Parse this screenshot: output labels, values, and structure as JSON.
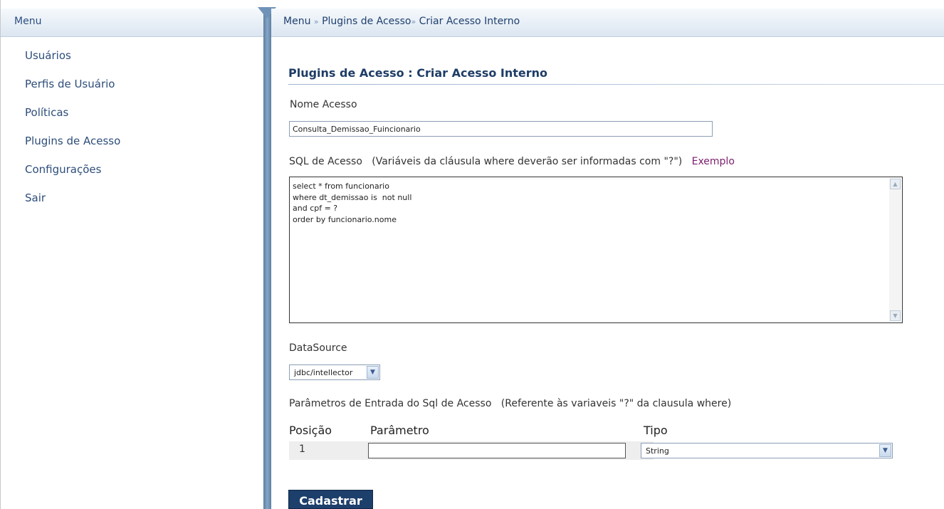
{
  "sidebar": {
    "title": "Menu",
    "items": [
      {
        "label": "Usuários"
      },
      {
        "label": "Perfis de Usuário"
      },
      {
        "label": "Políticas"
      },
      {
        "label": "Plugins de Acesso"
      },
      {
        "label": "Configurações"
      },
      {
        "label": "Sair"
      }
    ]
  },
  "breadcrumb": {
    "root": "Menu",
    "sep": "»",
    "section": "Plugins de Acesso",
    "current": "Criar Acesso Interno"
  },
  "page": {
    "title": "Plugins de Acesso : Criar Acesso Interno"
  },
  "form": {
    "nome_label": "Nome Acesso",
    "nome_value": "Consulta_Demissao_Fuincionario",
    "sql_label": "SQL de Acesso",
    "sql_hint": "(Variáveis da cláusula where deverão ser informadas com \"?\")",
    "sql_example_link": "Exemplo",
    "sql_value": "select * from funcionario\nwhere dt_demissao is  not null\nand cpf = ?\norder by funcionario.nome",
    "datasource_label": "DataSource",
    "datasource_value": "jdbc/intellector",
    "params_label": "Parâmetros de Entrada do Sql de Acesso",
    "params_hint": "(Referente às variaveis \"?\" da clausula where)",
    "params_columns": {
      "posicao": "Posição",
      "parametro": "Parâmetro",
      "tipo": "Tipo"
    },
    "params_rows": [
      {
        "posicao": "1",
        "parametro": "",
        "tipo": "String"
      }
    ],
    "submit_label": "Cadastrar"
  },
  "icons": {
    "scroll_up": "scroll-up-arrow-icon",
    "scroll_down": "scroll-down-arrow-icon",
    "dropdown": "chevron-down-icon"
  },
  "colors": {
    "header_gradient_top": "#f6f9fc",
    "header_gradient_bottom": "#dbe6f1",
    "splitter": "#6f93b8",
    "title": "#1e3d66",
    "link": "#7a1e6e",
    "button": "#1d3f6b"
  }
}
